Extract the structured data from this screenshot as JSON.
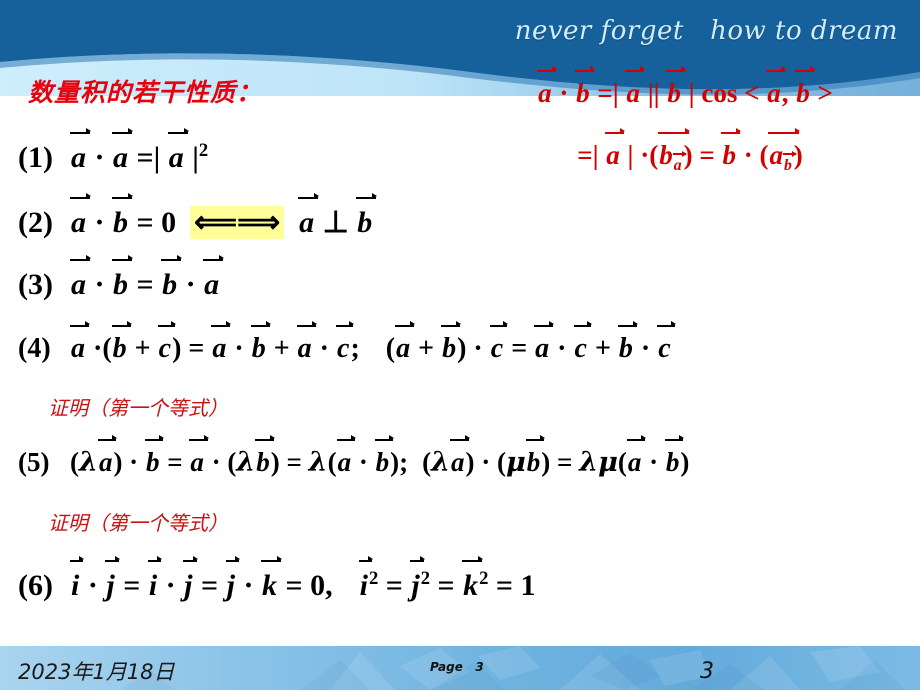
{
  "header": {
    "tagline": "never forget   how to dream",
    "band_color_dark": "#16609c",
    "band_color_wave_mid": "#7ab3dd",
    "band_color_wave_light": "#cdeefc"
  },
  "title": {
    "text": "数量积的若干性质：",
    "color": "#e8000d"
  },
  "red_formulas": {
    "line1_parts": {
      "a": "a",
      "dot": " · ",
      "b": "b",
      "eq": " =| ",
      "a2": "a",
      "bars": " || ",
      "b2": "b",
      "cos": " | cos < ",
      "a3": "a",
      "comma": ", ",
      "b3": "b",
      "gt": " >"
    },
    "line1_text": "a⃗ · b⃗ =| a⃗ || b⃗ | cos < a⃗, b⃗ >",
    "line2_text": "=| a⃗ | ·( b⃗ₐ⃗ ) = b⃗ · ( a⃗_b⃗ )",
    "color": "#d40000"
  },
  "properties": [
    {
      "num": "(1)",
      "text": "a⃗ · a⃗ =| a⃗ |²"
    },
    {
      "num": "(2)",
      "text": "a⃗ · b⃗ = 0  ⟸⟹  a⃗ ⊥ b⃗",
      "highlight_symbol": "⟸⟹",
      "highlight_color": "#ffff99"
    },
    {
      "num": "(3)",
      "text": "a⃗ · b⃗ = b⃗ · a⃗"
    },
    {
      "num": "(4)",
      "text": "a⃗ · ( b⃗ + c⃗ ) = a⃗ · b⃗ + a⃗ · c⃗;  ( a⃗ + b⃗ ) · c⃗ = a⃗ · c⃗ + b⃗ · c⃗"
    },
    {
      "num": "(5)",
      "text": "( λa⃗ ) · b⃗ = a⃗ · ( λb⃗ ) = λ( a⃗ · b⃗ );  ( λa⃗ ) · ( μb⃗ ) = λμ( a⃗ · b⃗ )"
    },
    {
      "num": "(6)",
      "text": "i⃗ · j⃗ = i⃗ · j⃗ = j⃗ · k⃗ = 0,   i⃗ ² = j⃗ ² = k⃗ ² = 1"
    }
  ],
  "proof_notes": {
    "after_prop4": "证明（第一个等式）",
    "after_prop5": "证明（第一个等式）",
    "color": "#cc1111"
  },
  "glyphs": {
    "a": "a",
    "b": "b",
    "c": "c",
    "i": "i",
    "j": "j",
    "k": "k",
    "lambda": "λ",
    "mu": "μ",
    "dot": "·",
    "equals": "=",
    "plus": "+",
    "bar": "|",
    "lparen": "(",
    "rparen": ")",
    "semicolon": ";",
    "comma": ",",
    "zero": "0",
    "one": "1",
    "two": "2",
    "perp": "⊥",
    "iff": "⟸⟹",
    "lt": "<",
    "gt": ">",
    "cos": "cos"
  },
  "footer": {
    "date": "2023年1月18日",
    "page_label": "Page",
    "page_label_num": "3",
    "page_number": "3"
  }
}
